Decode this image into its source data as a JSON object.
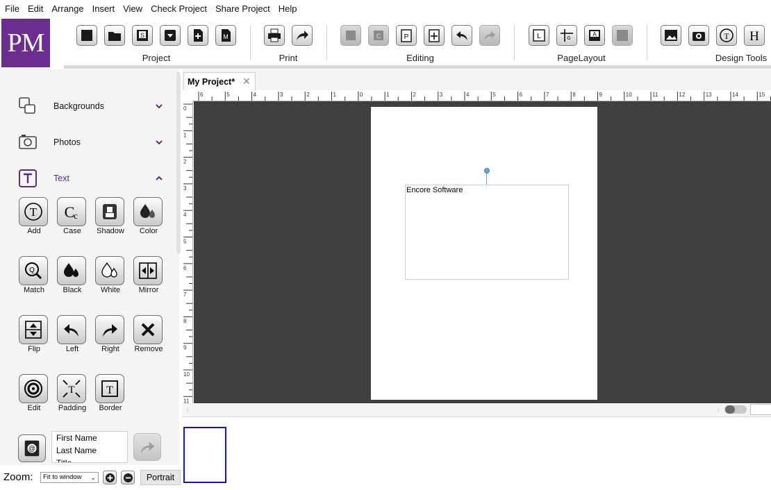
{
  "menu": [
    "File",
    "Edit",
    "Arrange",
    "Insert",
    "View",
    "Check Project",
    "Share Project",
    "Help"
  ],
  "logo": "PM",
  "ribbon": {
    "groups": [
      "Project",
      "Print",
      "Editing",
      "PageLayout",
      "Design Tools"
    ]
  },
  "left_panel": {
    "sections": [
      {
        "label": "Backgrounds",
        "icon": "backgrounds-icon",
        "expanded": false
      },
      {
        "label": "Photos",
        "icon": "photos-icon",
        "expanded": false
      },
      {
        "label": "Text",
        "icon": "text-icon",
        "expanded": true
      }
    ],
    "text_tools": [
      "Add",
      "Case",
      "Shadow",
      "Color",
      "Match",
      "Black",
      "White",
      "Mirror",
      "Flip",
      "Left",
      "Right",
      "Remove",
      "Edit",
      "Padding",
      "Border"
    ],
    "fields": [
      "First Name",
      "Last Name",
      "Title"
    ]
  },
  "zoom": {
    "label": "Zoom:",
    "value": "Fit to window",
    "orientation": "Portrait"
  },
  "document": {
    "tab_title": "My Project*",
    "textbox_text": "Encore Software"
  },
  "ruler": {
    "h_labels": [
      "6",
      "5",
      "4",
      "3",
      "2",
      "1",
      "0",
      "1",
      "2",
      "3",
      "4",
      "5",
      "6",
      "7",
      "8",
      "9",
      "10",
      "11",
      "12",
      "13",
      "14",
      "15"
    ],
    "v_labels": [
      "0",
      "1",
      "2",
      "3",
      "4",
      "5",
      "6",
      "7",
      "8",
      "9",
      "10",
      "11"
    ]
  },
  "colors": {
    "brand": "#6b2d8f",
    "canvas": "#404040",
    "selection": "#5aa9e6",
    "thumbnail_border": "#1212d6"
  }
}
